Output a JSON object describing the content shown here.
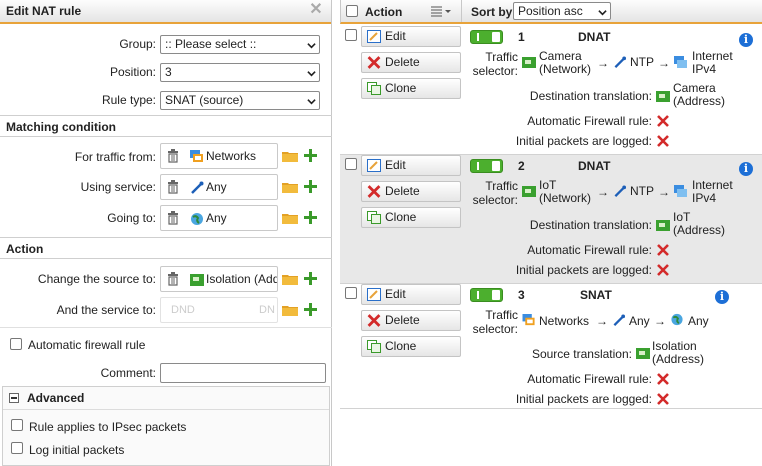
{
  "left_panel": {
    "title": "Edit NAT rule",
    "group_label": "Group:",
    "group_value": ":: Please select ::",
    "position_label": "Position:",
    "position_value": "3",
    "rule_type_label": "Rule type:",
    "rule_type_value": "SNAT (source)",
    "matching_heading": "Matching condition",
    "traffic_from_label": "For traffic from:",
    "traffic_from_value": "Networks",
    "service_label": "Using service:",
    "service_value": "Any",
    "going_to_label": "Going to:",
    "going_to_value": "Any",
    "action_heading": "Action",
    "change_source_label": "Change the source to:",
    "change_source_value": "Isolation (Add",
    "service_to_label": "And the service to:",
    "service_to_placeholder": "DND",
    "service_to_placeholder_right": "DN",
    "auto_fw_label": "Automatic firewall rule",
    "comment_label": "Comment:",
    "comment_value": "",
    "advanced_heading": "Advanced",
    "ipsec_label": "Rule applies to IPsec packets",
    "log_label": "Log initial packets"
  },
  "right_panel": {
    "action_col": "Action",
    "sort_label": "Sort by:",
    "sort_value": "Position asc",
    "buttons": {
      "edit": "Edit",
      "delete": "Delete",
      "clone": "Clone"
    },
    "labels": {
      "traffic": "Traffic",
      "selector": "selector:",
      "dest_translation": "Destination translation:",
      "source_translation": "Source translation:",
      "auto_fw": "Automatic Firewall rule:",
      "initial_logged": "Initial packets are logged:"
    },
    "rules": [
      {
        "number": "1",
        "type": "DNAT",
        "src1": "Camera",
        "src2": "(Network)",
        "service": "NTP",
        "dst1": "Internet",
        "dst2": "IPv4",
        "trans1": "Camera",
        "trans2": "(Address)"
      },
      {
        "number": "2",
        "type": "DNAT",
        "src1": "IoT",
        "src2": "(Network)",
        "service": "NTP",
        "dst1": "Internet",
        "dst2": "IPv4",
        "trans1": "IoT",
        "trans2": "(Address)"
      },
      {
        "number": "3",
        "type": "SNAT",
        "src1": "Networks",
        "service": "Any",
        "dst1": "Any",
        "trans1": "Isolation",
        "trans2": "(Address)"
      }
    ]
  },
  "colors": {
    "accent": "#e8a33a",
    "toggle_on": "#4caf2e",
    "info": "#1d6fd6",
    "delete_x": "#d32a2a",
    "add_plus": "#3a9a2a"
  }
}
